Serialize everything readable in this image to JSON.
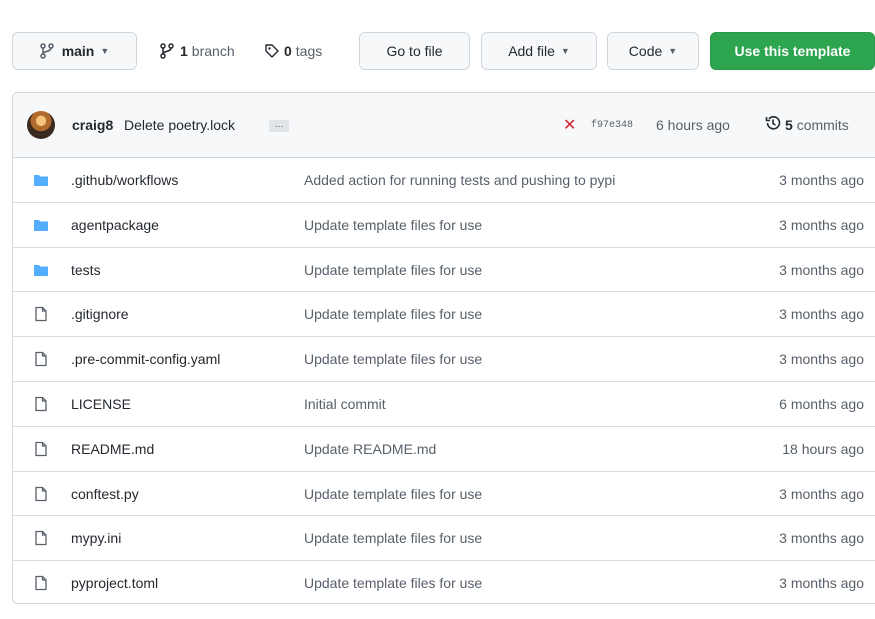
{
  "toolbar": {
    "branch_label": "main",
    "branches_count": "1",
    "branches_label": "branch",
    "tags_count": "0",
    "tags_label": "tags",
    "go_to_file": "Go to file",
    "add_file": "Add file",
    "code": "Code",
    "use_template": "Use this template"
  },
  "commit": {
    "author": "craig8",
    "message": "Delete poetry.lock",
    "ellipsis": "…",
    "status_icon": "x-fail-icon",
    "sha": "f97e348",
    "time": "6 hours ago",
    "commits_count": "5",
    "commits_label": "commits"
  },
  "files": [
    {
      "type": "folder",
      "name": ".github/workflows",
      "message": "Added action for running tests and pushing to pypi",
      "age": "3 months ago"
    },
    {
      "type": "folder",
      "name": "agentpackage",
      "message": "Update template files for use",
      "age": "3 months ago"
    },
    {
      "type": "folder",
      "name": "tests",
      "message": "Update template files for use",
      "age": "3 months ago"
    },
    {
      "type": "file",
      "name": ".gitignore",
      "message": "Update template files for use",
      "age": "3 months ago"
    },
    {
      "type": "file",
      "name": ".pre-commit-config.yaml",
      "message": "Update template files for use",
      "age": "3 months ago"
    },
    {
      "type": "file",
      "name": "LICENSE",
      "message": "Initial commit",
      "age": "6 months ago"
    },
    {
      "type": "file",
      "name": "README.md",
      "message": "Update README.md",
      "age": "18 hours ago"
    },
    {
      "type": "file",
      "name": "conftest.py",
      "message": "Update template files for use",
      "age": "3 months ago"
    },
    {
      "type": "file",
      "name": "mypy.ini",
      "message": "Update template files for use",
      "age": "3 months ago"
    },
    {
      "type": "file",
      "name": "pyproject.toml",
      "message": "Update template files for use",
      "age": "3 months ago"
    }
  ],
  "colors": {
    "folder": "#54aeff",
    "file_outline": "#57606a",
    "primary_button": "#2da44e",
    "fail": "#cf222e"
  }
}
